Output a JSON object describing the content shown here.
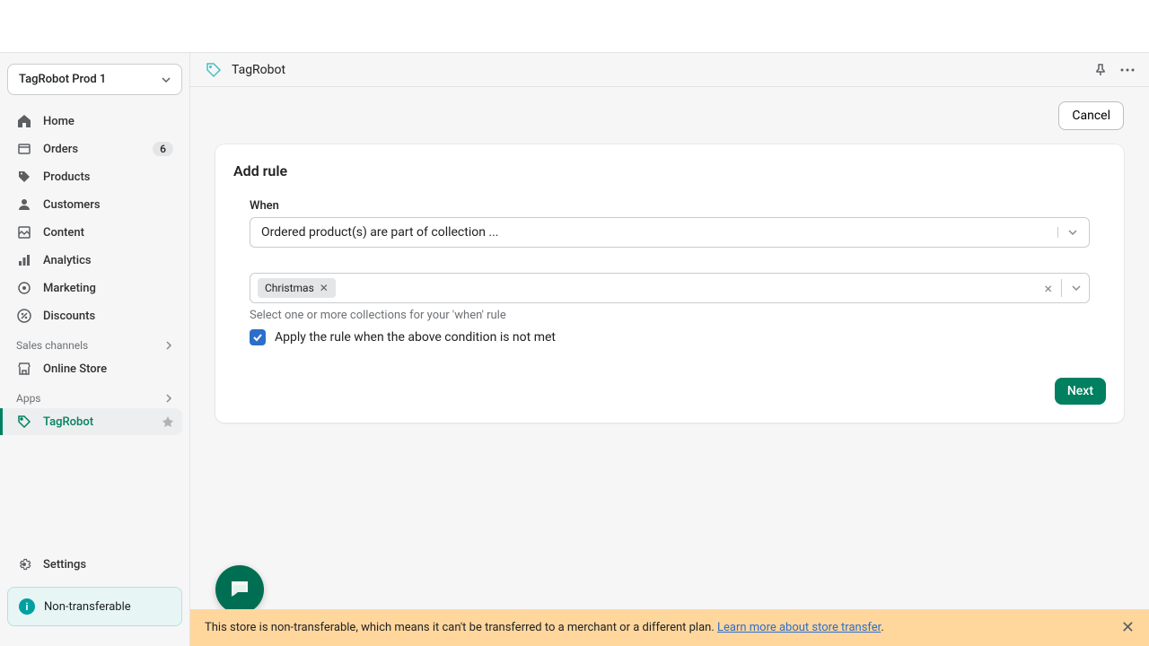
{
  "store_selector": {
    "label": "TagRobot Prod 1"
  },
  "nav": {
    "home": "Home",
    "orders": "Orders",
    "orders_badge": "6",
    "products": "Products",
    "customers": "Customers",
    "content": "Content",
    "analytics": "Analytics",
    "marketing": "Marketing",
    "discounts": "Discounts",
    "sales_channels_header": "Sales channels",
    "online_store": "Online Store",
    "apps_header": "Apps",
    "tagrobot": "TagRobot",
    "settings": "Settings",
    "nontransfer": "Non-transferable"
  },
  "header": {
    "app_title": "TagRobot"
  },
  "actions": {
    "cancel": "Cancel",
    "next": "Next"
  },
  "card": {
    "title": "Add rule",
    "when_label": "When",
    "when_value": "Ordered product(s) are part of collection ...",
    "tag_value": "Christmas",
    "helper": "Select one or more collections for your 'when' rule",
    "checkbox_label": "Apply the rule when the above condition is not met"
  },
  "banner": {
    "text": "This store is non-transferable, which means it can't be transferred to a merchant or a different plan. ",
    "link_text": "Learn more about store transfer",
    "suffix": "."
  }
}
